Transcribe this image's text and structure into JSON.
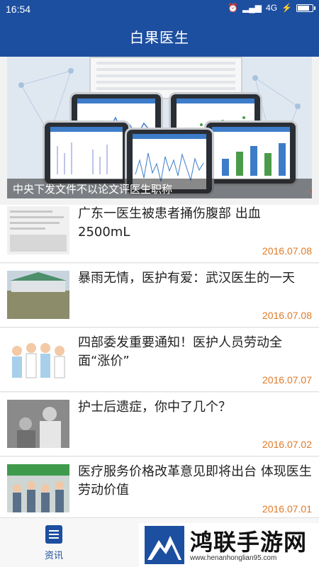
{
  "status_bar": {
    "time": "16:54",
    "network": "4G"
  },
  "header": {
    "title": "白果医生"
  },
  "banner": {
    "caption": "中央下发文件不以论文评医生职称",
    "slide_count": 3,
    "active_slide": 3
  },
  "articles": [
    {
      "title": "广东一医生被患者捅伤腹部 出血2500mL",
      "date": "2016.07.08"
    },
    {
      "title": "暴雨无情，医护有爱：武汉医生的一天",
      "date": "2016.07.08"
    },
    {
      "title": "四部委发重要通知！医护人员劳动全面“涨价”",
      "date": "2016.07.07"
    },
    {
      "title": "护士后遗症，你中了几个？",
      "date": "2016.07.02"
    },
    {
      "title": "医疗服务价格改革意见即将出台 体现医生劳动价值",
      "date": "2016.07.01"
    }
  ],
  "bottom_nav": {
    "tabs": [
      {
        "label": "资讯",
        "active": true
      }
    ]
  },
  "watermark": {
    "name": "鸿联手游网",
    "url": "www.henanhonglian95.com"
  },
  "colors": {
    "primary": "#1d4fa0",
    "date": "#e07a27",
    "dot_active": "#e0443a"
  }
}
